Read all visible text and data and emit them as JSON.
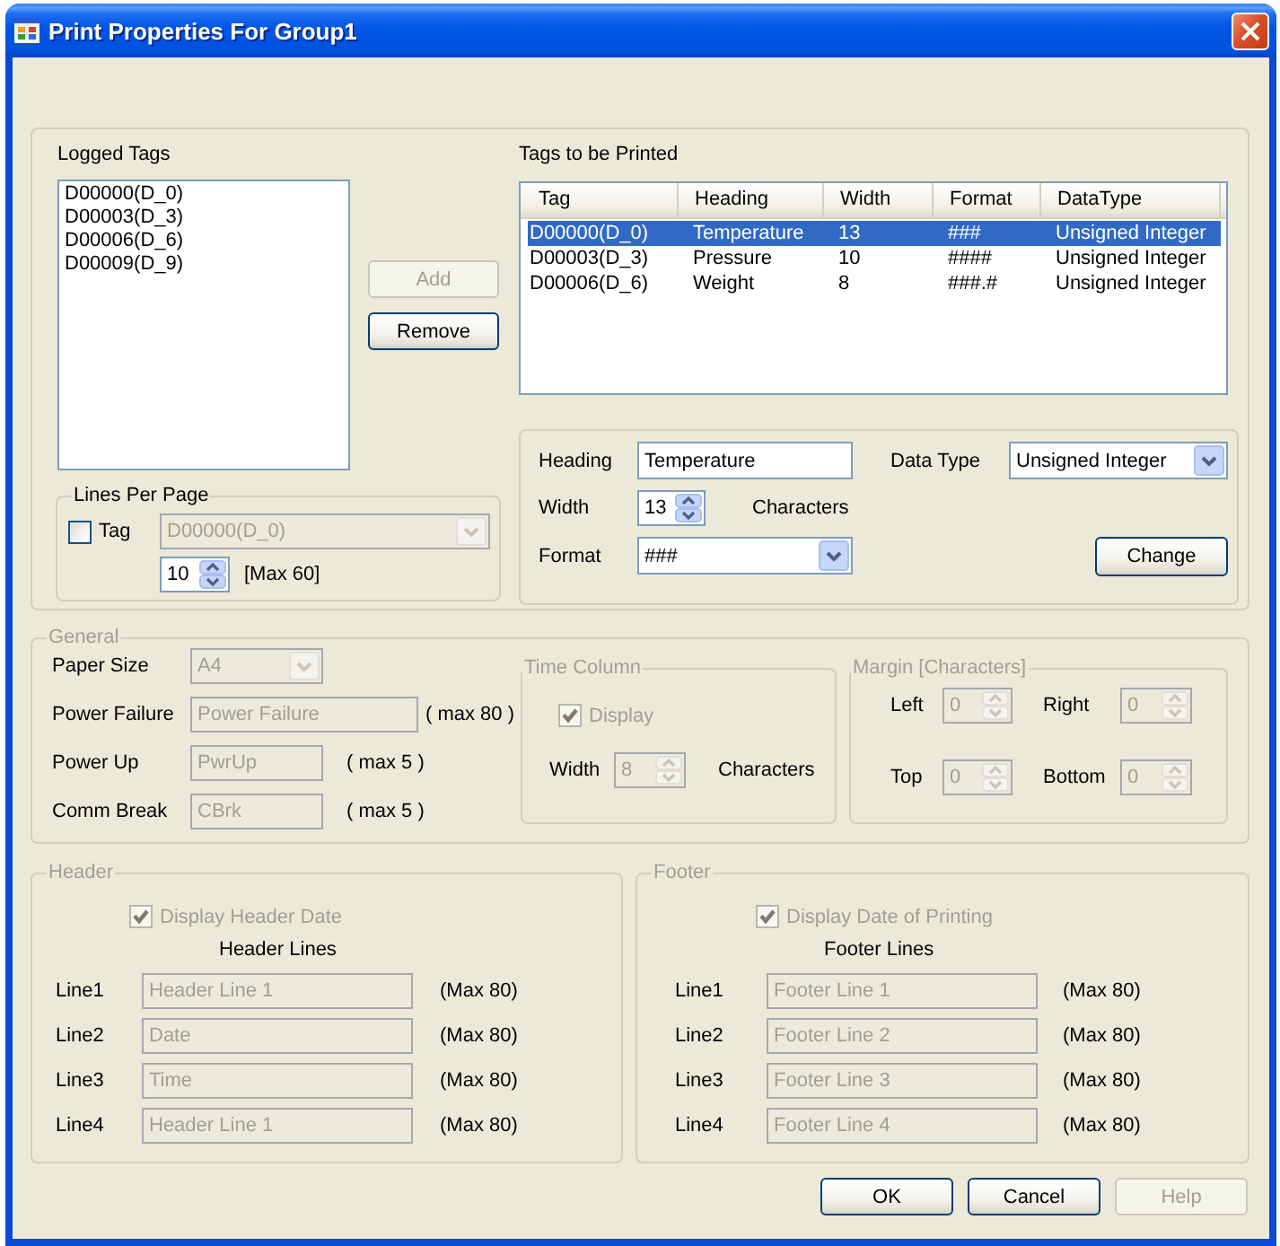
{
  "window": {
    "title": "Print Properties For Group1"
  },
  "logged_tags": {
    "label": "Logged Tags",
    "items": [
      {
        "text": "D00000(D_0)",
        "selected": false
      },
      {
        "text": "D00003(D_3)",
        "selected": false
      },
      {
        "text": "D00006(D_6)",
        "selected": false
      },
      {
        "text": "D00009(D_9)",
        "selected": false
      }
    ]
  },
  "tag_buttons": [
    {
      "label": "Add",
      "disabled": true
    },
    {
      "label": "Remove",
      "disabled": false
    }
  ],
  "lines_per_page": {
    "title": "Lines Per Page",
    "tag_checkbox": {
      "label": "Tag",
      "checked": false
    },
    "tag_select": {
      "value": "D00000(D_0)",
      "disabled": true
    },
    "lines": {
      "value": "10"
    },
    "note": "[Max 60]"
  },
  "tags_to_print": {
    "label": "Tags to be Printed",
    "columns": [
      "Tag",
      "Heading",
      "Width",
      "Format",
      "DataType"
    ],
    "rows": [
      {
        "cells": [
          "D00000(D_0)",
          "Temperature",
          "13",
          "###",
          "Unsigned Integer"
        ],
        "selected": true
      },
      {
        "cells": [
          "D00003(D_3)",
          "Pressure",
          "10",
          "####",
          "Unsigned Integer"
        ],
        "selected": false
      },
      {
        "cells": [
          "D00006(D_6)",
          "Weight",
          "8",
          "###.#",
          "Unsigned Integer"
        ],
        "selected": false
      }
    ]
  },
  "column_editor": {
    "heading": {
      "label": "Heading",
      "value": "Temperature"
    },
    "data_type": {
      "label": "Data Type",
      "value": "Unsigned Integer"
    },
    "width": {
      "label": "Width",
      "value": "13",
      "unit": "Characters"
    },
    "format": {
      "label": "Format",
      "value": "###"
    },
    "change_button": {
      "label": "Change"
    }
  },
  "general": {
    "title": "General",
    "disabled": true,
    "paper_size": {
      "label": "Paper Size",
      "value": "A4"
    },
    "fields": [
      {
        "kind": "long",
        "label": "Power Failure",
        "value": "Power Failure",
        "note": "( max 80 )"
      },
      {
        "kind": "short",
        "label": "Power Up",
        "value": "PwrUp",
        "note": "( max 5 )"
      },
      {
        "kind": "short",
        "label": "Comm Break",
        "value": "CBrk",
        "note": "( max 5 )"
      }
    ]
  },
  "time_column": {
    "title": "Time Column",
    "disabled": true,
    "display": {
      "label": "Display",
      "checked": true
    },
    "width": {
      "label": "Width",
      "value": "8",
      "unit": "Characters"
    }
  },
  "margin": {
    "title": "Margin [Characters]",
    "disabled": true,
    "fields": [
      {
        "label": "Left",
        "value": "0"
      },
      {
        "label": "Right",
        "value": "0"
      },
      {
        "label": "Top",
        "value": "0"
      },
      {
        "label": "Bottom",
        "value": "0"
      }
    ]
  },
  "header": {
    "title": "Header",
    "disabled": true,
    "date_checkbox": {
      "label": "Display Header Date",
      "checked": true
    },
    "lines_title": "Header Lines",
    "lines": [
      {
        "label": "Line1",
        "value": "Header Line 1",
        "note": "(Max 80)"
      },
      {
        "label": "Line2",
        "value": "Date",
        "note": "(Max 80)"
      },
      {
        "label": "Line3",
        "value": "Time",
        "note": "(Max 80)"
      },
      {
        "label": "Line4",
        "value": "Header Line 1",
        "note": "(Max 80)"
      }
    ]
  },
  "footer": {
    "title": "Footer",
    "disabled": true,
    "date_checkbox": {
      "label": "Display Date of Printing",
      "checked": true
    },
    "lines_title": "Footer Lines",
    "lines": [
      {
        "label": "Line1",
        "value": "Footer Line 1",
        "note": "(Max 80)"
      },
      {
        "label": "Line2",
        "value": "Footer Line 2",
        "note": "(Max 80)"
      },
      {
        "label": "Line3",
        "value": "Footer Line 3",
        "note": "(Max 80)"
      },
      {
        "label": "Line4",
        "value": "Footer Line 4",
        "note": "(Max 80)"
      }
    ]
  },
  "dialog_buttons": [
    {
      "label": "OK",
      "disabled": false
    },
    {
      "label": "Cancel",
      "disabled": false
    },
    {
      "label": "Help",
      "disabled": true
    }
  ]
}
